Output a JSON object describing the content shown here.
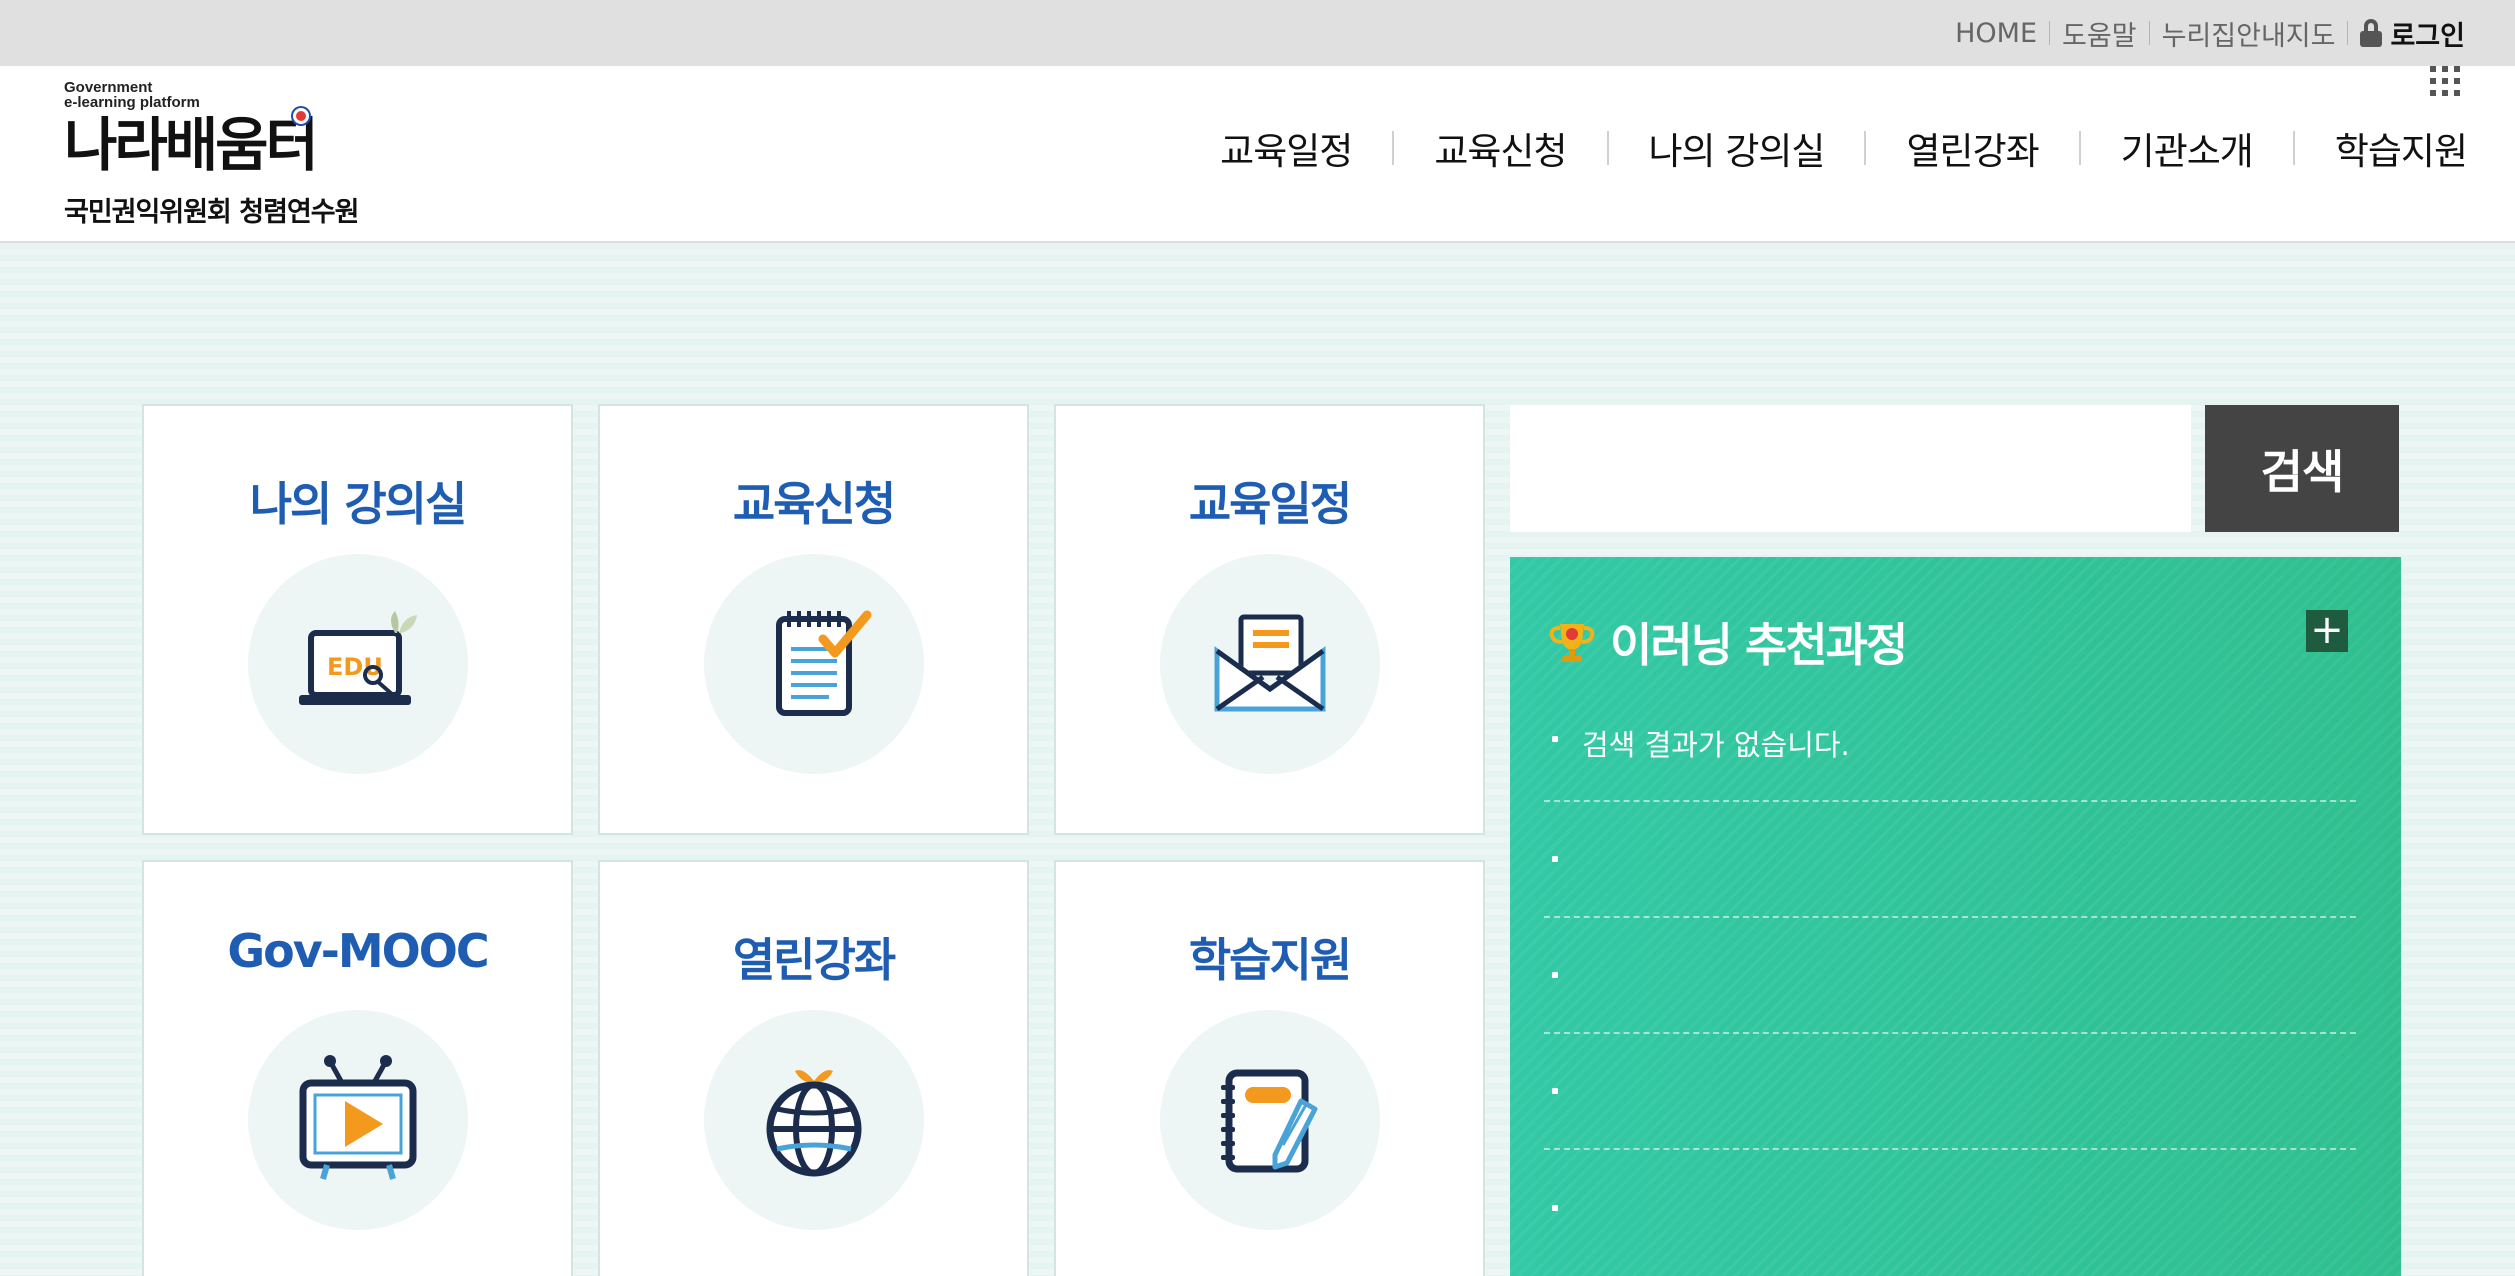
{
  "util": {
    "home": "HOME",
    "help": "도움말",
    "sitemap": "누리집안내지도",
    "login": "로그인"
  },
  "logo": {
    "sub1": "Government",
    "sub2": "e-learning platform",
    "main": "나라배움터",
    "org": "국민권익위원회 청렴연수원"
  },
  "nav": [
    "교육일정",
    "교육신청",
    "나의 강의실",
    "열린강좌",
    "기관소개",
    "학습지원"
  ],
  "tiles": [
    {
      "title": "나의 강의실",
      "icon": "laptop-edu-icon"
    },
    {
      "title": "교육신청",
      "icon": "notepad-check-icon"
    },
    {
      "title": "교육일정",
      "icon": "envelope-icon"
    },
    {
      "title": "Gov-MOOC",
      "icon": "tv-play-icon"
    },
    {
      "title": "열린강좌",
      "icon": "globe-icon"
    },
    {
      "title": "학습지원",
      "icon": "notebook-pencil-icon"
    }
  ],
  "search": {
    "placeholder": "",
    "button": "검색"
  },
  "reco": {
    "title": "이러닝 추천과정",
    "more": "+",
    "items": [
      "검색 결과가 없습니다.",
      "",
      "",
      "",
      ""
    ]
  },
  "colors": {
    "accent": "#1f5db3",
    "panel": "#33c9a6",
    "orange": "#f39a1e",
    "navy": "#1c2c4c",
    "sky": "#4aa3d8"
  }
}
